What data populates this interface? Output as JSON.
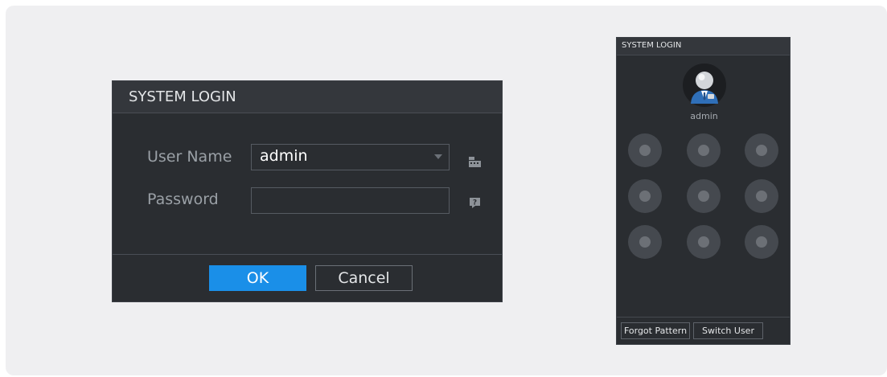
{
  "login_dialog": {
    "title": "SYSTEM LOGIN",
    "username_label": "User Name",
    "username_value": "admin",
    "password_label": "Password",
    "password_value": "",
    "ok_label": "OK",
    "cancel_label": "Cancel"
  },
  "pattern_panel": {
    "title": "SYSTEM LOGIN",
    "username": "admin",
    "forgot_label": "Forgot Pattern",
    "switch_label": "Switch User"
  },
  "colors": {
    "accent": "#1a8fe8",
    "dialog_bg": "#2a2d31",
    "titlebar_bg": "#34373c"
  },
  "icons": {
    "keyboard": "keyboard-icon",
    "password_hint": "question-icon",
    "dropdown": "chevron-down-icon",
    "avatar": "user-avatar-icon"
  }
}
